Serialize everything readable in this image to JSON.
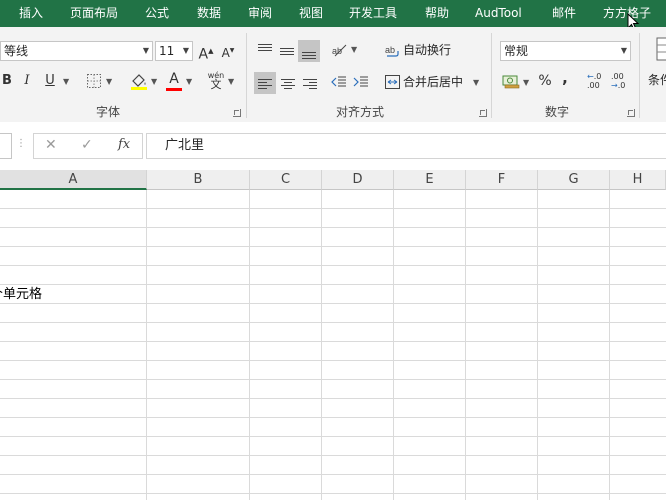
{
  "tabs": [
    "插入",
    "页面布局",
    "公式",
    "数据",
    "审阅",
    "视图",
    "开发工具",
    "帮助",
    "AudTool",
    "邮件",
    "方方格子"
  ],
  "font": {
    "name": "等线",
    "size": "11",
    "bold": "B",
    "italic": "I",
    "underline": "U",
    "fill_color": "#ffff00",
    "font_color": "#ff0000",
    "group_label": "字体"
  },
  "alignment": {
    "wrap_label": "自动换行",
    "merge_label": "合并后居中",
    "group_label": "对齐方式"
  },
  "number": {
    "format": "常规",
    "percent": "%",
    "comma": ",",
    "inc_decimal": "←.0 .00",
    "dec_decimal": ".00 →.0",
    "group_label": "数字"
  },
  "styles": {
    "partial_label": "条件"
  },
  "formula_bar": {
    "value": "广北里",
    "fx": "fx"
  },
  "columns": [
    "A",
    "B",
    "C",
    "D",
    "E",
    "F",
    "G",
    "H"
  ],
  "cells": {
    "a6_partial": "个单元格"
  },
  "colors": {
    "accent": "#217346"
  }
}
